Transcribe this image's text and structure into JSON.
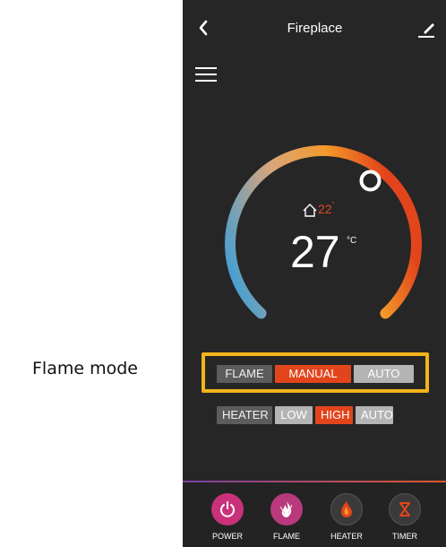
{
  "caption": "Flame mode",
  "header": {
    "title": "Fireplace"
  },
  "thermostat": {
    "inside_temp": "22",
    "inside_unit": "°",
    "set_temp": "27",
    "set_unit": "°C"
  },
  "flame_row": {
    "label": "FLAME",
    "options": [
      "MANUAL",
      "AUTO"
    ],
    "selected": "MANUAL"
  },
  "heater_row": {
    "label": "HEATER",
    "options": [
      "LOW",
      "HIGH",
      "AUTO"
    ],
    "selected": "HIGH"
  },
  "nav": [
    {
      "label": "POWER",
      "icon": "power-icon"
    },
    {
      "label": "FLAME",
      "icon": "flame-icon"
    },
    {
      "label": "HEATER",
      "icon": "heater-icon"
    },
    {
      "label": "TIMER",
      "icon": "hourglass-icon"
    }
  ],
  "colors": {
    "background": "#262626",
    "accent": "#e2451c",
    "highlight": "#f3b31a",
    "gauge_cool": "#2f9ee0",
    "gauge_warm": "#f39a2a"
  }
}
